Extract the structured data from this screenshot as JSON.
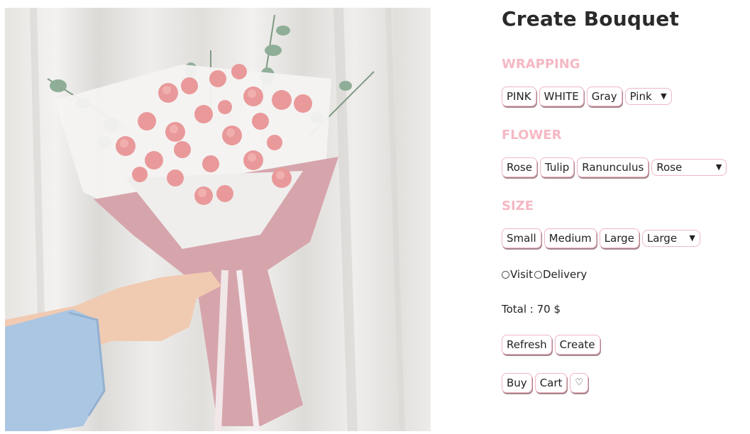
{
  "title": "Create Bouquet",
  "wrapping": {
    "label": "WRAPPING",
    "options": [
      "PINK",
      "WHITE",
      "Gray"
    ],
    "selected": "Pink"
  },
  "flower": {
    "label": "FLOWER",
    "options": [
      "Rose",
      "Tulip",
      "Ranunculus"
    ],
    "selected": "Rose"
  },
  "size": {
    "label": "SIZE",
    "options": [
      "Small",
      "Medium",
      "Large"
    ],
    "selected": "Large"
  },
  "delivery": {
    "options": [
      "Visit",
      "Delivery"
    ]
  },
  "total": "Total : 70 $",
  "actions": {
    "refresh": "Refresh",
    "create": "Create",
    "buy": "Buy",
    "cart": "Cart",
    "favorite": "♡"
  },
  "colors": {
    "accent": "#f5b8c4",
    "button_border": "#f0b7c4"
  }
}
